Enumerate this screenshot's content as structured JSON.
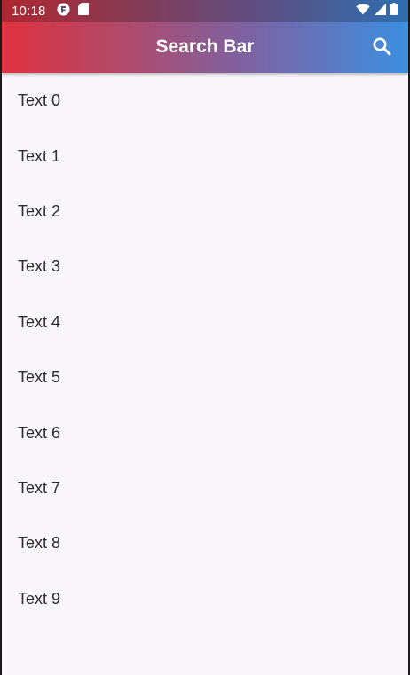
{
  "status_bar": {
    "time": "10:18",
    "left_icons": [
      "app-notification-icon",
      "sd-card-icon"
    ],
    "right_icons": [
      "wifi-icon",
      "cell-signal-icon",
      "battery-icon"
    ]
  },
  "app_bar": {
    "title": "Search Bar",
    "action_icon": "search-icon",
    "gradient_colors": [
      "#e0323f",
      "#7a64a6",
      "#3c8fe0"
    ]
  },
  "list": {
    "items": [
      {
        "label": "Text 0"
      },
      {
        "label": "Text 1"
      },
      {
        "label": "Text 2"
      },
      {
        "label": "Text 3"
      },
      {
        "label": "Text 4"
      },
      {
        "label": "Text 5"
      },
      {
        "label": "Text 6"
      },
      {
        "label": "Text 7"
      },
      {
        "label": "Text 8"
      },
      {
        "label": "Text 9"
      }
    ]
  },
  "colors": {
    "background": "#f8f6fa",
    "text": "#2b2b2b",
    "on_app_bar": "#ffffff"
  }
}
